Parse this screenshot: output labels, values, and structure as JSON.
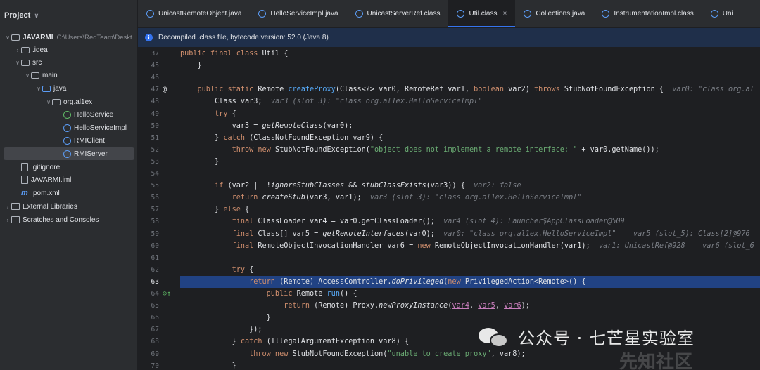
{
  "project": {
    "title": "Project",
    "items": [
      {
        "arrow": "∨",
        "icon": "folder",
        "label": "JAVARMI",
        "path": "C:\\Users\\RedTeam\\Deskt",
        "bold": true
      },
      {
        "arrow": "›",
        "icon": "folder",
        "label": ".idea"
      },
      {
        "arrow": "∨",
        "icon": "folder",
        "label": "src"
      },
      {
        "arrow": "∨",
        "icon": "folder",
        "label": "main"
      },
      {
        "arrow": "∨",
        "icon": "folder-blue",
        "label": "java"
      },
      {
        "arrow": "∨",
        "icon": "folder",
        "label": "org.al1ex"
      },
      {
        "arrow": "",
        "icon": "interface",
        "label": "HelloService"
      },
      {
        "arrow": "",
        "icon": "class",
        "label": "HelloServiceImpl"
      },
      {
        "arrow": "",
        "icon": "class",
        "label": "RMIClient"
      },
      {
        "arrow": "",
        "icon": "class",
        "label": "RMIServer"
      },
      {
        "arrow": "",
        "icon": "file",
        "label": ".gitignore"
      },
      {
        "arrow": "",
        "icon": "file",
        "label": "JAVARMI.iml"
      },
      {
        "arrow": "",
        "icon": "maven",
        "label": "pom.xml"
      },
      {
        "arrow": "›",
        "icon": "library",
        "label": "External Libraries"
      },
      {
        "arrow": "›",
        "icon": "scratch",
        "label": "Scratches and Consoles"
      }
    ]
  },
  "tabs": [
    {
      "label": "UnicastRemoteObject.java"
    },
    {
      "label": "HelloServiceImpl.java"
    },
    {
      "label": "UnicastServerRef.class"
    },
    {
      "label": "Util.class",
      "active": true,
      "close": "×"
    },
    {
      "label": "Collections.java"
    },
    {
      "label": "InstrumentationImpl.class"
    },
    {
      "label": "Uni"
    }
  ],
  "banner": {
    "icon": "i",
    "text": "Decompiled .class file, bytecode version: 52.0 (Java 8)"
  },
  "watermark": {
    "text": "公众号 · 七芒星实验室",
    "corner": "先知社区"
  },
  "editor": {
    "lines": [
      {
        "n": "37",
        "code": [
          [
            "kw",
            "public final class "
          ],
          [
            "",
            "Util {"
          ]
        ]
      },
      {
        "n": "45",
        "code": [
          [
            "",
            "    }"
          ]
        ]
      },
      {
        "n": "46",
        "code": []
      },
      {
        "n": "47",
        "mark": "@",
        "code": [
          [
            "kw",
            "    public static "
          ],
          [
            "",
            "Remote "
          ],
          [
            "fn",
            "createProxy"
          ],
          [
            "",
            "(Class<?> var0, RemoteRef var1, "
          ],
          [
            "kw",
            "boolean "
          ],
          [
            "",
            "var2) "
          ],
          [
            "kw",
            "throws "
          ],
          [
            "",
            "StubNotFoundException {  "
          ],
          [
            "hint",
            "var0: \"class org.al"
          ]
        ]
      },
      {
        "n": "48",
        "code": [
          [
            "",
            "        Class var3;  "
          ],
          [
            "hint",
            "var3 (slot_3): \"class org.al1ex.HelloServiceImpl\""
          ]
        ]
      },
      {
        "n": "49",
        "code": [
          [
            "kw",
            "        try "
          ],
          [
            "",
            "{"
          ]
        ]
      },
      {
        "n": "50",
        "code": [
          [
            "",
            "            var3 = "
          ],
          [
            "ita",
            "getRemoteClass"
          ],
          [
            "",
            "(var0);"
          ]
        ]
      },
      {
        "n": "51",
        "code": [
          [
            "",
            "        } "
          ],
          [
            "kw",
            "catch "
          ],
          [
            "",
            "(ClassNotFoundException var9) {"
          ]
        ]
      },
      {
        "n": "52",
        "code": [
          [
            "kw",
            "            throw new "
          ],
          [
            "",
            "StubNotFoundException("
          ],
          [
            "str",
            "\"object does not implement a remote interface: \""
          ],
          [
            "",
            " + var0.getName());"
          ]
        ]
      },
      {
        "n": "53",
        "code": [
          [
            "",
            "        }"
          ]
        ]
      },
      {
        "n": "54",
        "code": []
      },
      {
        "n": "55",
        "code": [
          [
            "kw",
            "        if "
          ],
          [
            "",
            "(var2 || !"
          ],
          [
            "ita",
            "ignoreStubClasses "
          ],
          [
            "",
            "&& "
          ],
          [
            "ita",
            "stubClassExists"
          ],
          [
            "",
            "(var3)) {  "
          ],
          [
            "hint",
            "var2: false"
          ]
        ]
      },
      {
        "n": "56",
        "code": [
          [
            "kw",
            "            return "
          ],
          [
            "ita",
            "createStub"
          ],
          [
            "",
            "(var3, var1);  "
          ],
          [
            "hint",
            "var3 (slot_3): \"class org.al1ex.HelloServiceImpl\""
          ]
        ]
      },
      {
        "n": "57",
        "code": [
          [
            "",
            "        } "
          ],
          [
            "kw",
            "else "
          ],
          [
            "",
            "{"
          ]
        ]
      },
      {
        "n": "58",
        "code": [
          [
            "kw",
            "            final "
          ],
          [
            "",
            "ClassLoader var4 = var0.getClassLoader();  "
          ],
          [
            "hint",
            "var4 (slot_4): Launcher$AppClassLoader@509"
          ]
        ]
      },
      {
        "n": "59",
        "code": [
          [
            "kw",
            "            final "
          ],
          [
            "",
            "Class[] var5 = "
          ],
          [
            "ita",
            "getRemoteInterfaces"
          ],
          [
            "",
            "(var0);  "
          ],
          [
            "hint",
            "var0: \"class org.al1ex.HelloServiceImpl\"    var5 (slot_5): Class[2]@976"
          ]
        ]
      },
      {
        "n": "60",
        "code": [
          [
            "kw",
            "            final "
          ],
          [
            "",
            "RemoteObjectInvocationHandler var6 = "
          ],
          [
            "kw",
            "new "
          ],
          [
            "",
            "RemoteObjectInvocationHandler(var1);  "
          ],
          [
            "hint",
            "var1: UnicastRef@928    var6 (slot_6"
          ]
        ]
      },
      {
        "n": "61",
        "code": []
      },
      {
        "n": "62",
        "code": [
          [
            "kw",
            "            try "
          ],
          [
            "",
            "{"
          ]
        ]
      },
      {
        "n": "63",
        "hl": true,
        "code": [
          [
            "kw",
            "                return "
          ],
          [
            "",
            "(Remote) AccessController."
          ],
          [
            "ita",
            "doPrivileged"
          ],
          [
            "",
            "("
          ],
          [
            "kw",
            "new "
          ],
          [
            "",
            "PrivilegedAction<Remote>() {"
          ]
        ]
      },
      {
        "n": "64",
        "mark": "⊙↑",
        "impl": true,
        "code": [
          [
            "kw",
            "                    public "
          ],
          [
            "",
            "Remote "
          ],
          [
            "fn",
            "run"
          ],
          [
            "",
            "() {"
          ]
        ]
      },
      {
        "n": "65",
        "code": [
          [
            "kw",
            "                        return "
          ],
          [
            "",
            "(Remote) Proxy."
          ],
          [
            "ita",
            "newProxyInstance"
          ],
          [
            "",
            "("
          ],
          [
            "pur",
            "var4"
          ],
          [
            "",
            ", "
          ],
          [
            "pur",
            "var5"
          ],
          [
            "",
            ", "
          ],
          [
            "pur",
            "var6"
          ],
          [
            "",
            ");"
          ]
        ]
      },
      {
        "n": "66",
        "code": [
          [
            "",
            "                    }"
          ]
        ]
      },
      {
        "n": "67",
        "code": [
          [
            "",
            "                });"
          ]
        ]
      },
      {
        "n": "68",
        "code": [
          [
            "",
            "            } "
          ],
          [
            "kw",
            "catch "
          ],
          [
            "",
            "(IllegalArgumentException var8) {"
          ]
        ]
      },
      {
        "n": "69",
        "code": [
          [
            "kw",
            "                throw new "
          ],
          [
            "",
            "StubNotFoundException("
          ],
          [
            "str",
            "\"unable to create proxy\""
          ],
          [
            "",
            ", var8);"
          ]
        ]
      },
      {
        "n": "70",
        "code": [
          [
            "",
            "            }"
          ]
        ]
      }
    ]
  }
}
